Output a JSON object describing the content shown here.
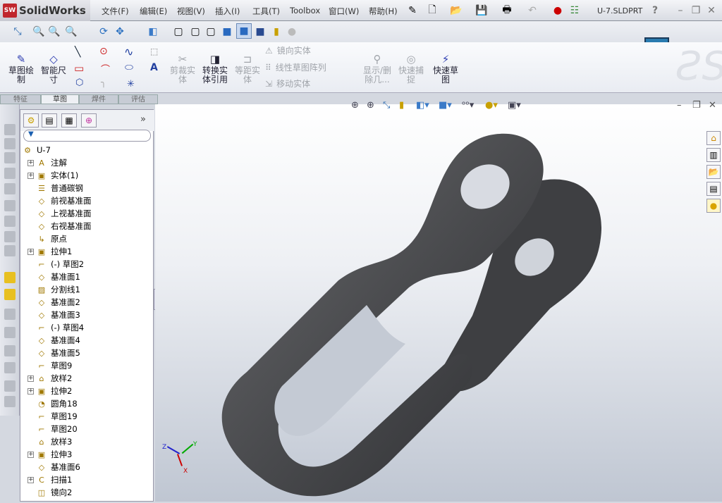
{
  "app": {
    "name": "SolidWorks",
    "logo_text": "SW",
    "document": "U-7.SLDPRT"
  },
  "menu": [
    "文件(F)",
    "编辑(E)",
    "视图(V)",
    "插入(I)",
    "工具(T)",
    "Toolbox",
    "窗口(W)",
    "帮助(H)"
  ],
  "command_manager": {
    "buttons": [
      {
        "label": "草图绘制",
        "enabled": true
      },
      {
        "label": "智能尺寸",
        "enabled": true
      },
      {
        "label": "剪裁实体",
        "enabled": false
      },
      {
        "label": "转换实体引用",
        "enabled": true
      },
      {
        "label": "等距实体",
        "enabled": false
      },
      {
        "label": "显示/删除几...",
        "enabled": false
      },
      {
        "label": "快速捕捉",
        "enabled": false
      },
      {
        "label": "快速草图",
        "enabled": true
      }
    ],
    "small": [
      "镜向实体",
      "线性草图阵列",
      "移动实体"
    ],
    "tabs": [
      "特征",
      "草图",
      "焊件",
      "评估"
    ],
    "active_tab": "草图"
  },
  "tree": {
    "root": "U-7",
    "items": [
      {
        "label": "注解",
        "icon": "annotation-icon",
        "expandable": true
      },
      {
        "label": "实体(1)",
        "icon": "solid-bodies-icon",
        "expandable": true
      },
      {
        "label": "普通碳钢",
        "icon": "material-icon",
        "expandable": false
      },
      {
        "label": "前视基准面",
        "icon": "plane-icon",
        "expandable": false
      },
      {
        "label": "上视基准面",
        "icon": "plane-icon",
        "expandable": false
      },
      {
        "label": "右视基准面",
        "icon": "plane-icon",
        "expandable": false
      },
      {
        "label": "原点",
        "icon": "origin-icon",
        "expandable": false
      },
      {
        "label": "拉伸1",
        "icon": "extrude-icon",
        "expandable": true
      },
      {
        "label": "(-) 草图2",
        "icon": "sketch-icon",
        "expandable": false
      },
      {
        "label": "基准面1",
        "icon": "plane-icon",
        "expandable": false
      },
      {
        "label": "分割线1",
        "icon": "split-line-icon",
        "expandable": false
      },
      {
        "label": "基准面2",
        "icon": "plane-icon",
        "expandable": false
      },
      {
        "label": "基准面3",
        "icon": "plane-icon",
        "expandable": false
      },
      {
        "label": "(-) 草图4",
        "icon": "sketch-icon",
        "expandable": false
      },
      {
        "label": "基准面4",
        "icon": "plane-icon",
        "expandable": false
      },
      {
        "label": "基准面5",
        "icon": "plane-icon",
        "expandable": false
      },
      {
        "label": "草图9",
        "icon": "sketch-icon",
        "expandable": false
      },
      {
        "label": "放样2",
        "icon": "loft-icon",
        "expandable": true
      },
      {
        "label": "拉伸2",
        "icon": "extrude-icon",
        "expandable": true
      },
      {
        "label": "圆角18",
        "icon": "fillet-icon",
        "expandable": false
      },
      {
        "label": "草图19",
        "icon": "sketch-icon",
        "expandable": false
      },
      {
        "label": "草图20",
        "icon": "sketch-icon",
        "expandable": false
      },
      {
        "label": "放样3",
        "icon": "loft-icon",
        "expandable": false
      },
      {
        "label": "拉伸3",
        "icon": "extrude-icon",
        "expandable": true
      },
      {
        "label": "基准面6",
        "icon": "plane-icon",
        "expandable": false
      },
      {
        "label": "扫描1",
        "icon": "sweep-icon",
        "expandable": true
      },
      {
        "label": "镜向2",
        "icon": "mirror-icon",
        "expandable": false
      }
    ]
  },
  "triad": {
    "x": "X",
    "y": "Y",
    "z": "Z"
  },
  "colors": {
    "part": "#4a4b4e",
    "accent": "#2a7bb0"
  }
}
